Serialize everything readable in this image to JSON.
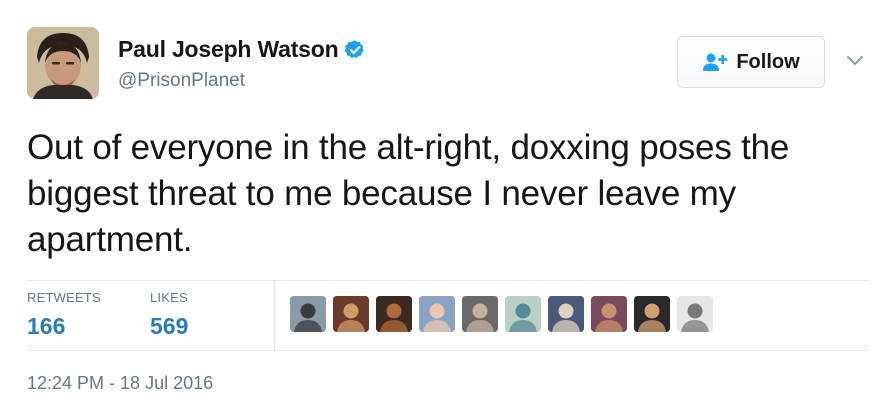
{
  "author": {
    "display_name": "Paul Joseph Watson",
    "handle": "@PrisonPlanet",
    "verified": true,
    "avatar_icon": "user-avatar"
  },
  "actions": {
    "follow_label": "Follow",
    "follow_icon": "add-user-icon",
    "menu_icon": "chevron-down-icon"
  },
  "tweet": {
    "text": "Out of everyone in the alt-right, doxxing poses the biggest threat to me because I never leave my apartment.",
    "timestamp": "12:24 PM - 18 Jul 2016"
  },
  "stats": {
    "retweets_label": "RETWEETS",
    "retweets_count": "166",
    "likes_label": "LIKES",
    "likes_count": "569"
  },
  "colors": {
    "accent": "#2b7bb9",
    "verified": "#1da1f2",
    "muted": "#657786",
    "divider": "#e1e8ed"
  },
  "likers": [
    {
      "name": "liker-avatar-1",
      "bg": "#8a9aa6",
      "fg": "#3b3b44"
    },
    {
      "name": "liker-avatar-2",
      "bg": "#6b3b2a",
      "fg": "#d39a6a"
    },
    {
      "name": "liker-avatar-3",
      "bg": "#3a2a22",
      "fg": "#b06a3a"
    },
    {
      "name": "liker-avatar-4",
      "bg": "#8aa3c4",
      "fg": "#e8c8b0"
    },
    {
      "name": "liker-avatar-5",
      "bg": "#6a6a6a",
      "fg": "#c8b0a0"
    },
    {
      "name": "liker-avatar-6",
      "bg": "#b8d0c8",
      "fg": "#5a8a9a"
    },
    {
      "name": "liker-avatar-7",
      "bg": "#4a5a7a",
      "fg": "#e0d0c0"
    },
    {
      "name": "liker-avatar-8",
      "bg": "#7a4a5a",
      "fg": "#c89070"
    },
    {
      "name": "liker-avatar-9",
      "bg": "#2a2a2a",
      "fg": "#d0a070"
    },
    {
      "name": "liker-avatar-10",
      "bg": "#e6e6e6",
      "fg": "#7a7a7a"
    }
  ]
}
